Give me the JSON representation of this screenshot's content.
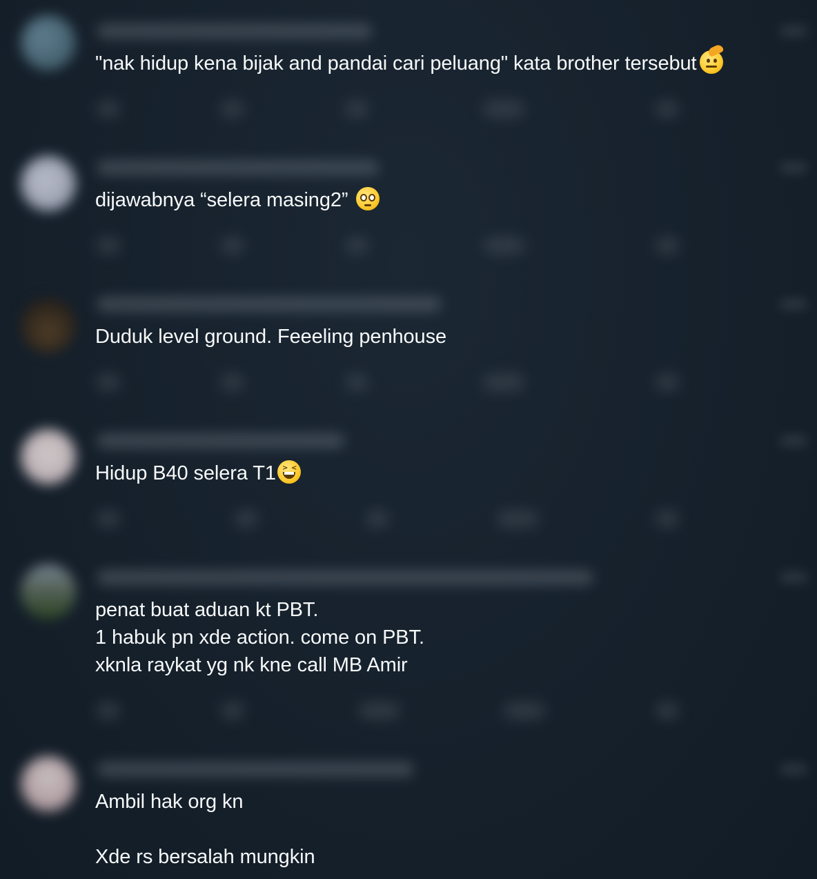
{
  "replies": [
    {
      "lines": [
        "\"nak hidup kena bijak and pandai cari peluang\" kata brother tersebut"
      ],
      "emoji": "saluting-face"
    },
    {
      "lines": [
        "dijawabnya “selera masing2”"
      ],
      "emoji": "pleading-face"
    },
    {
      "lines": [
        "Duduk level ground. Feeeling penhouse"
      ],
      "emoji": ""
    },
    {
      "lines": [
        "Hidup B40 selera T1"
      ],
      "emoji": "grinning-squinting-face"
    },
    {
      "lines": [
        "penat buat aduan kt PBT.",
        "1 habuk pn xde action. come on PBT.",
        "xknla raykat yg nk kne call MB Amir"
      ],
      "emoji": ""
    },
    {
      "lines": [
        "Ambil hak org kn",
        "",
        "Xde rs bersalah mungkin"
      ],
      "emoji": ""
    }
  ],
  "colors": {
    "background": "#15202b",
    "text": "#f7f9f9"
  }
}
